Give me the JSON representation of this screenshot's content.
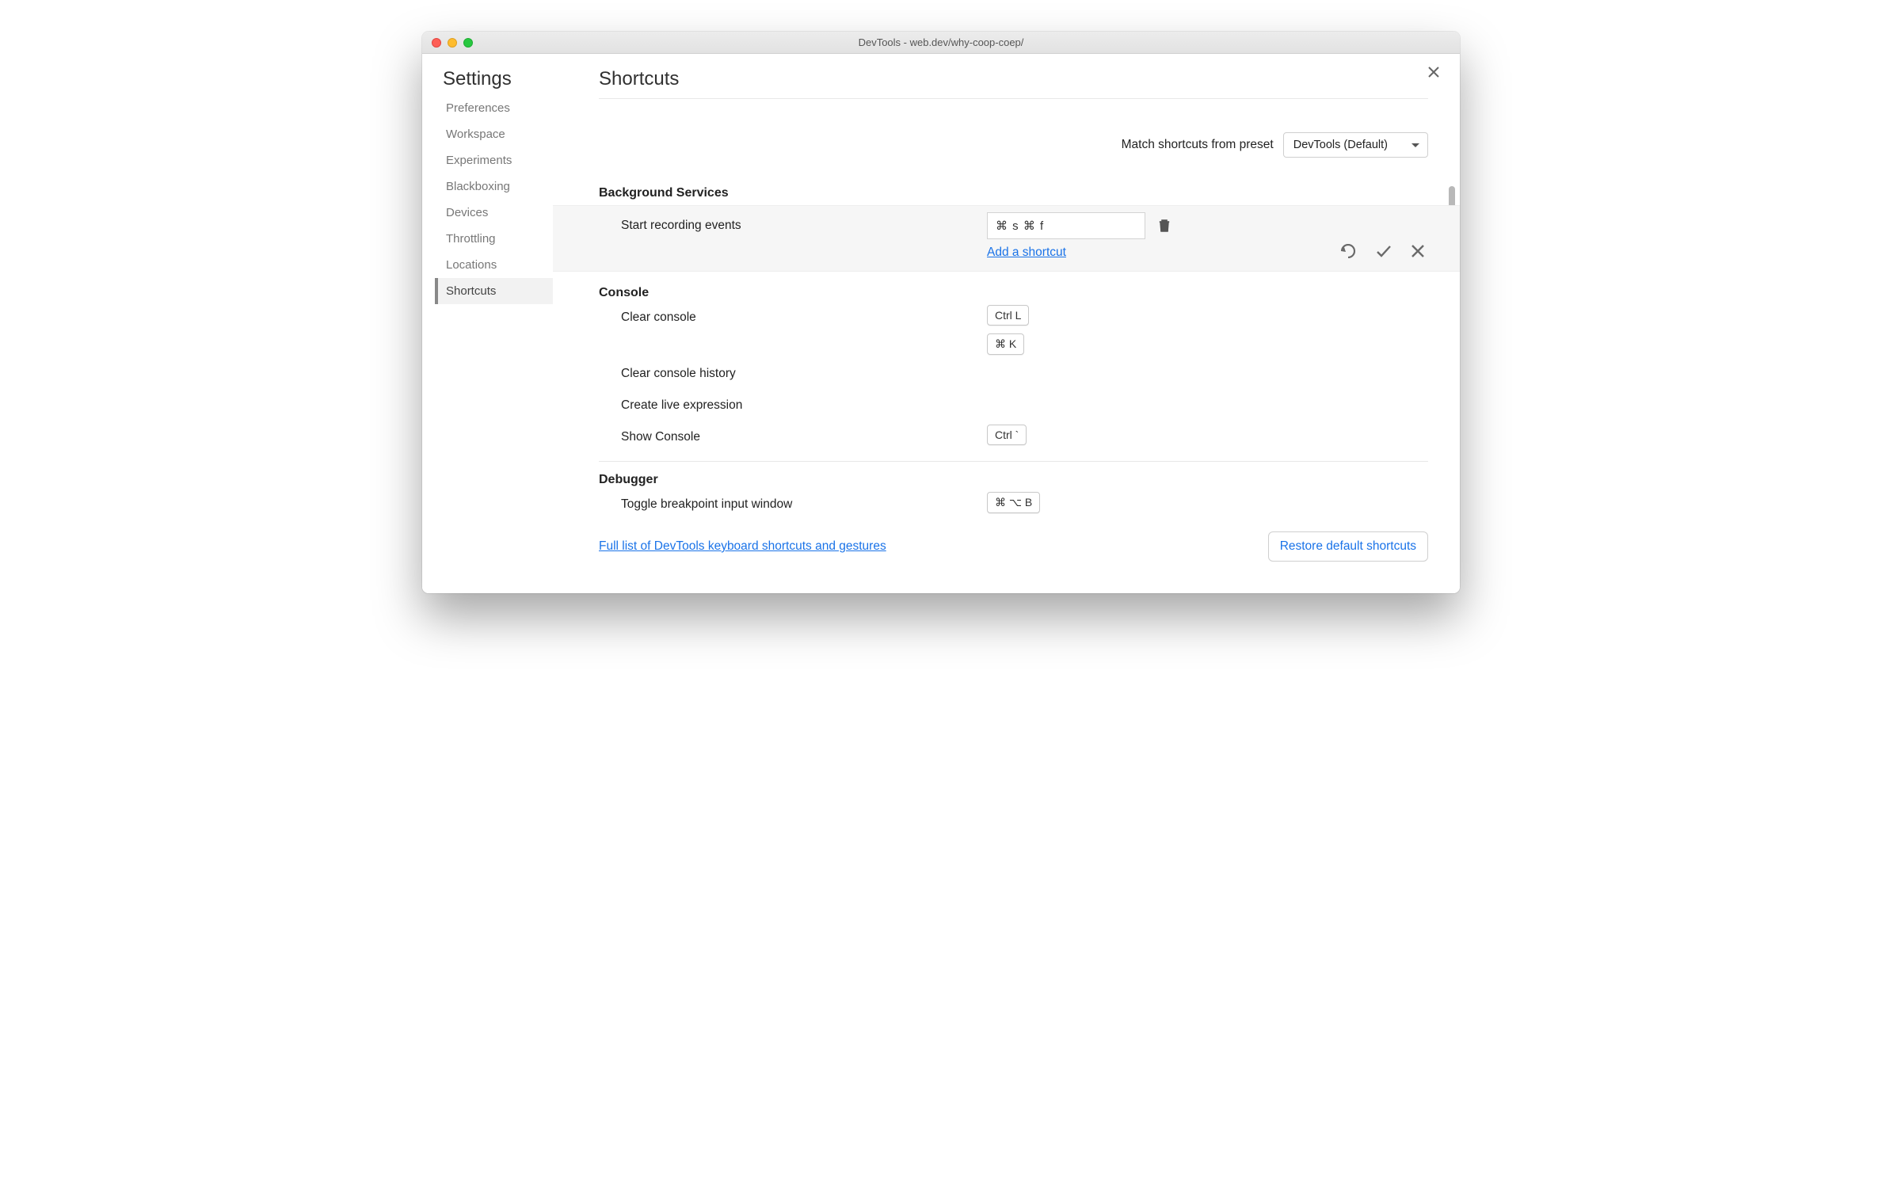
{
  "window": {
    "title": "DevTools - web.dev/why-coop-coep/"
  },
  "sidebar": {
    "title": "Settings",
    "items": [
      {
        "label": "Preferences",
        "active": false
      },
      {
        "label": "Workspace",
        "active": false
      },
      {
        "label": "Experiments",
        "active": false
      },
      {
        "label": "Blackboxing",
        "active": false
      },
      {
        "label": "Devices",
        "active": false
      },
      {
        "label": "Throttling",
        "active": false
      },
      {
        "label": "Locations",
        "active": false
      },
      {
        "label": "Shortcuts",
        "active": true
      }
    ]
  },
  "page": {
    "title": "Shortcuts",
    "preset_label": "Match shortcuts from preset",
    "preset_value": "DevTools (Default)"
  },
  "sections": {
    "bg": {
      "header": "Background Services",
      "row_label": "Start recording events",
      "edit_value": "⌘ s ⌘ f",
      "add_link": "Add a shortcut"
    },
    "console": {
      "header": "Console",
      "r1": {
        "label": "Clear console",
        "k1": "Ctrl L",
        "k2": "⌘ K"
      },
      "r2": {
        "label": "Clear console history"
      },
      "r3": {
        "label": "Create live expression"
      },
      "r4": {
        "label": "Show Console",
        "k1": "Ctrl `"
      }
    },
    "debugger": {
      "header": "Debugger",
      "r1": {
        "label": "Toggle breakpoint input window",
        "k1": "⌘ ⌥ B"
      }
    }
  },
  "footer": {
    "link": "Full list of DevTools keyboard shortcuts and gestures",
    "restore": "Restore default shortcuts"
  }
}
